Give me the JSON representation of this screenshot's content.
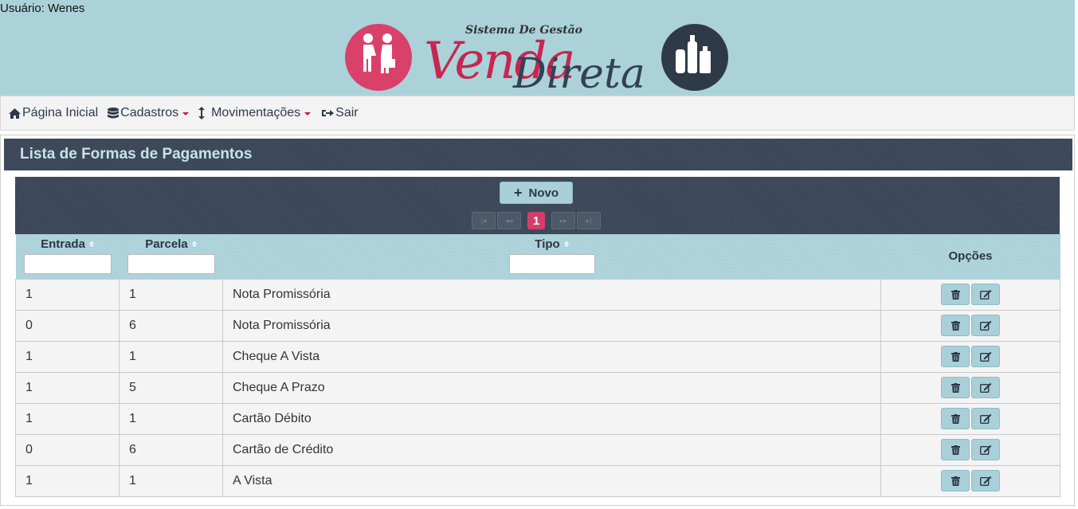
{
  "header": {
    "user_label": "Usuário: Wenes",
    "logo": {
      "tagline": "Sistema De Gestão",
      "word1": "Venda",
      "word2": "Direta"
    }
  },
  "menu": {
    "items": [
      {
        "label": "Página Inicial",
        "icon": "home-icon"
      },
      {
        "label": "Cadastros",
        "icon": "database-icon",
        "dropdown": true
      },
      {
        "label": "Movimentações",
        "icon": "vertical-arrows-icon",
        "dropdown": true
      },
      {
        "label": "Sair",
        "icon": "sign-out-icon"
      }
    ]
  },
  "panel": {
    "title": "Lista de Formas de Pagamentos",
    "new_button": "Novo",
    "pager": {
      "current_page": "1"
    }
  },
  "table": {
    "columns": [
      "Entrada",
      "Parcela",
      "Tipo",
      "Opções"
    ],
    "rows": [
      {
        "entrada": "1",
        "parcela": "1",
        "tipo": "Nota Promissória"
      },
      {
        "entrada": "0",
        "parcela": "6",
        "tipo": "Nota Promissória"
      },
      {
        "entrada": "1",
        "parcela": "1",
        "tipo": "Cheque A Vista"
      },
      {
        "entrada": "1",
        "parcela": "5",
        "tipo": "Cheque A Prazo"
      },
      {
        "entrada": "1",
        "parcela": "1",
        "tipo": "Cartão Débito"
      },
      {
        "entrada": "0",
        "parcela": "6",
        "tipo": "Cartão de Crédito"
      },
      {
        "entrada": "1",
        "parcela": "1",
        "tipo": "A Vista"
      }
    ]
  },
  "colors": {
    "header_bg": "#abd2d9",
    "dark_bar": "#3a4658",
    "accent_pink": "#d43f6a",
    "button_bg": "#a9d0d8"
  }
}
